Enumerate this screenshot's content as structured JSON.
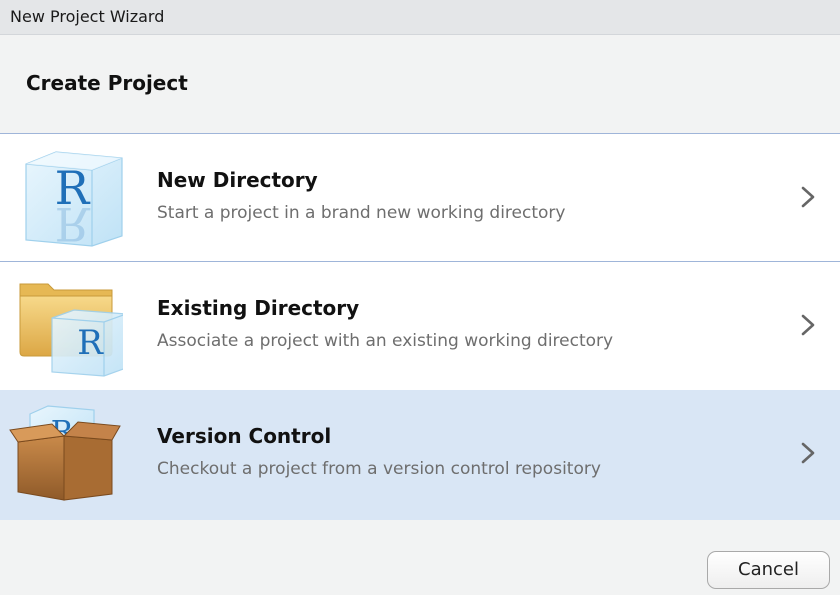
{
  "window": {
    "title": "New Project Wizard"
  },
  "header": {
    "title": "Create Project"
  },
  "options": [
    {
      "title": "New Directory",
      "description": "Start a project in a brand new working directory",
      "icon": "r-cube-icon"
    },
    {
      "title": "Existing Directory",
      "description": "Associate a project with an existing working directory",
      "icon": "folder-r-cube-icon"
    },
    {
      "title": "Version Control",
      "description": "Checkout a project from a version control repository",
      "icon": "box-r-cube-icon",
      "selected": true
    }
  ],
  "footer": {
    "cancel_label": "Cancel"
  },
  "colors": {
    "selected_bg": "#d9e6f5",
    "separator": "#9fb5d9",
    "window_bg": "#f2f3f3"
  }
}
